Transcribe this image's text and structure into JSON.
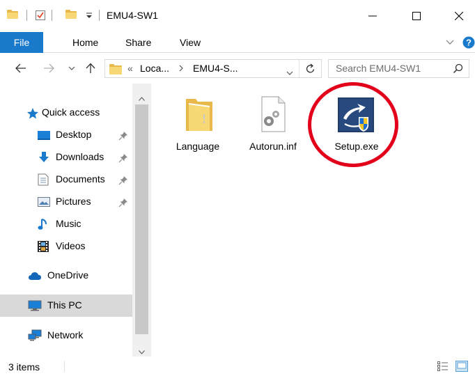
{
  "window": {
    "title": "EMU4-SW1"
  },
  "ribbon": {
    "tabs": [
      "File",
      "Home",
      "Share",
      "View"
    ]
  },
  "address": {
    "overflow": "«",
    "crumbs": [
      "Loca...",
      "EMU4-S..."
    ],
    "search_placeholder": "Search EMU4-SW1"
  },
  "nav": {
    "quick_access": "Quick access",
    "items": [
      "Desktop",
      "Downloads",
      "Documents",
      "Pictures",
      "Music",
      "Videos"
    ],
    "onedrive": "OneDrive",
    "this_pc": "This PC",
    "network": "Network"
  },
  "files": [
    {
      "name": "Language",
      "icon": "folder-icon"
    },
    {
      "name": "Autorun.inf",
      "icon": "settings-file-icon"
    },
    {
      "name": "Setup.exe",
      "icon": "setup-exe-icon"
    }
  ],
  "status": {
    "count": "3 items"
  },
  "colors": {
    "accent": "#1979ca",
    "highlight_circle": "#e2001a"
  }
}
